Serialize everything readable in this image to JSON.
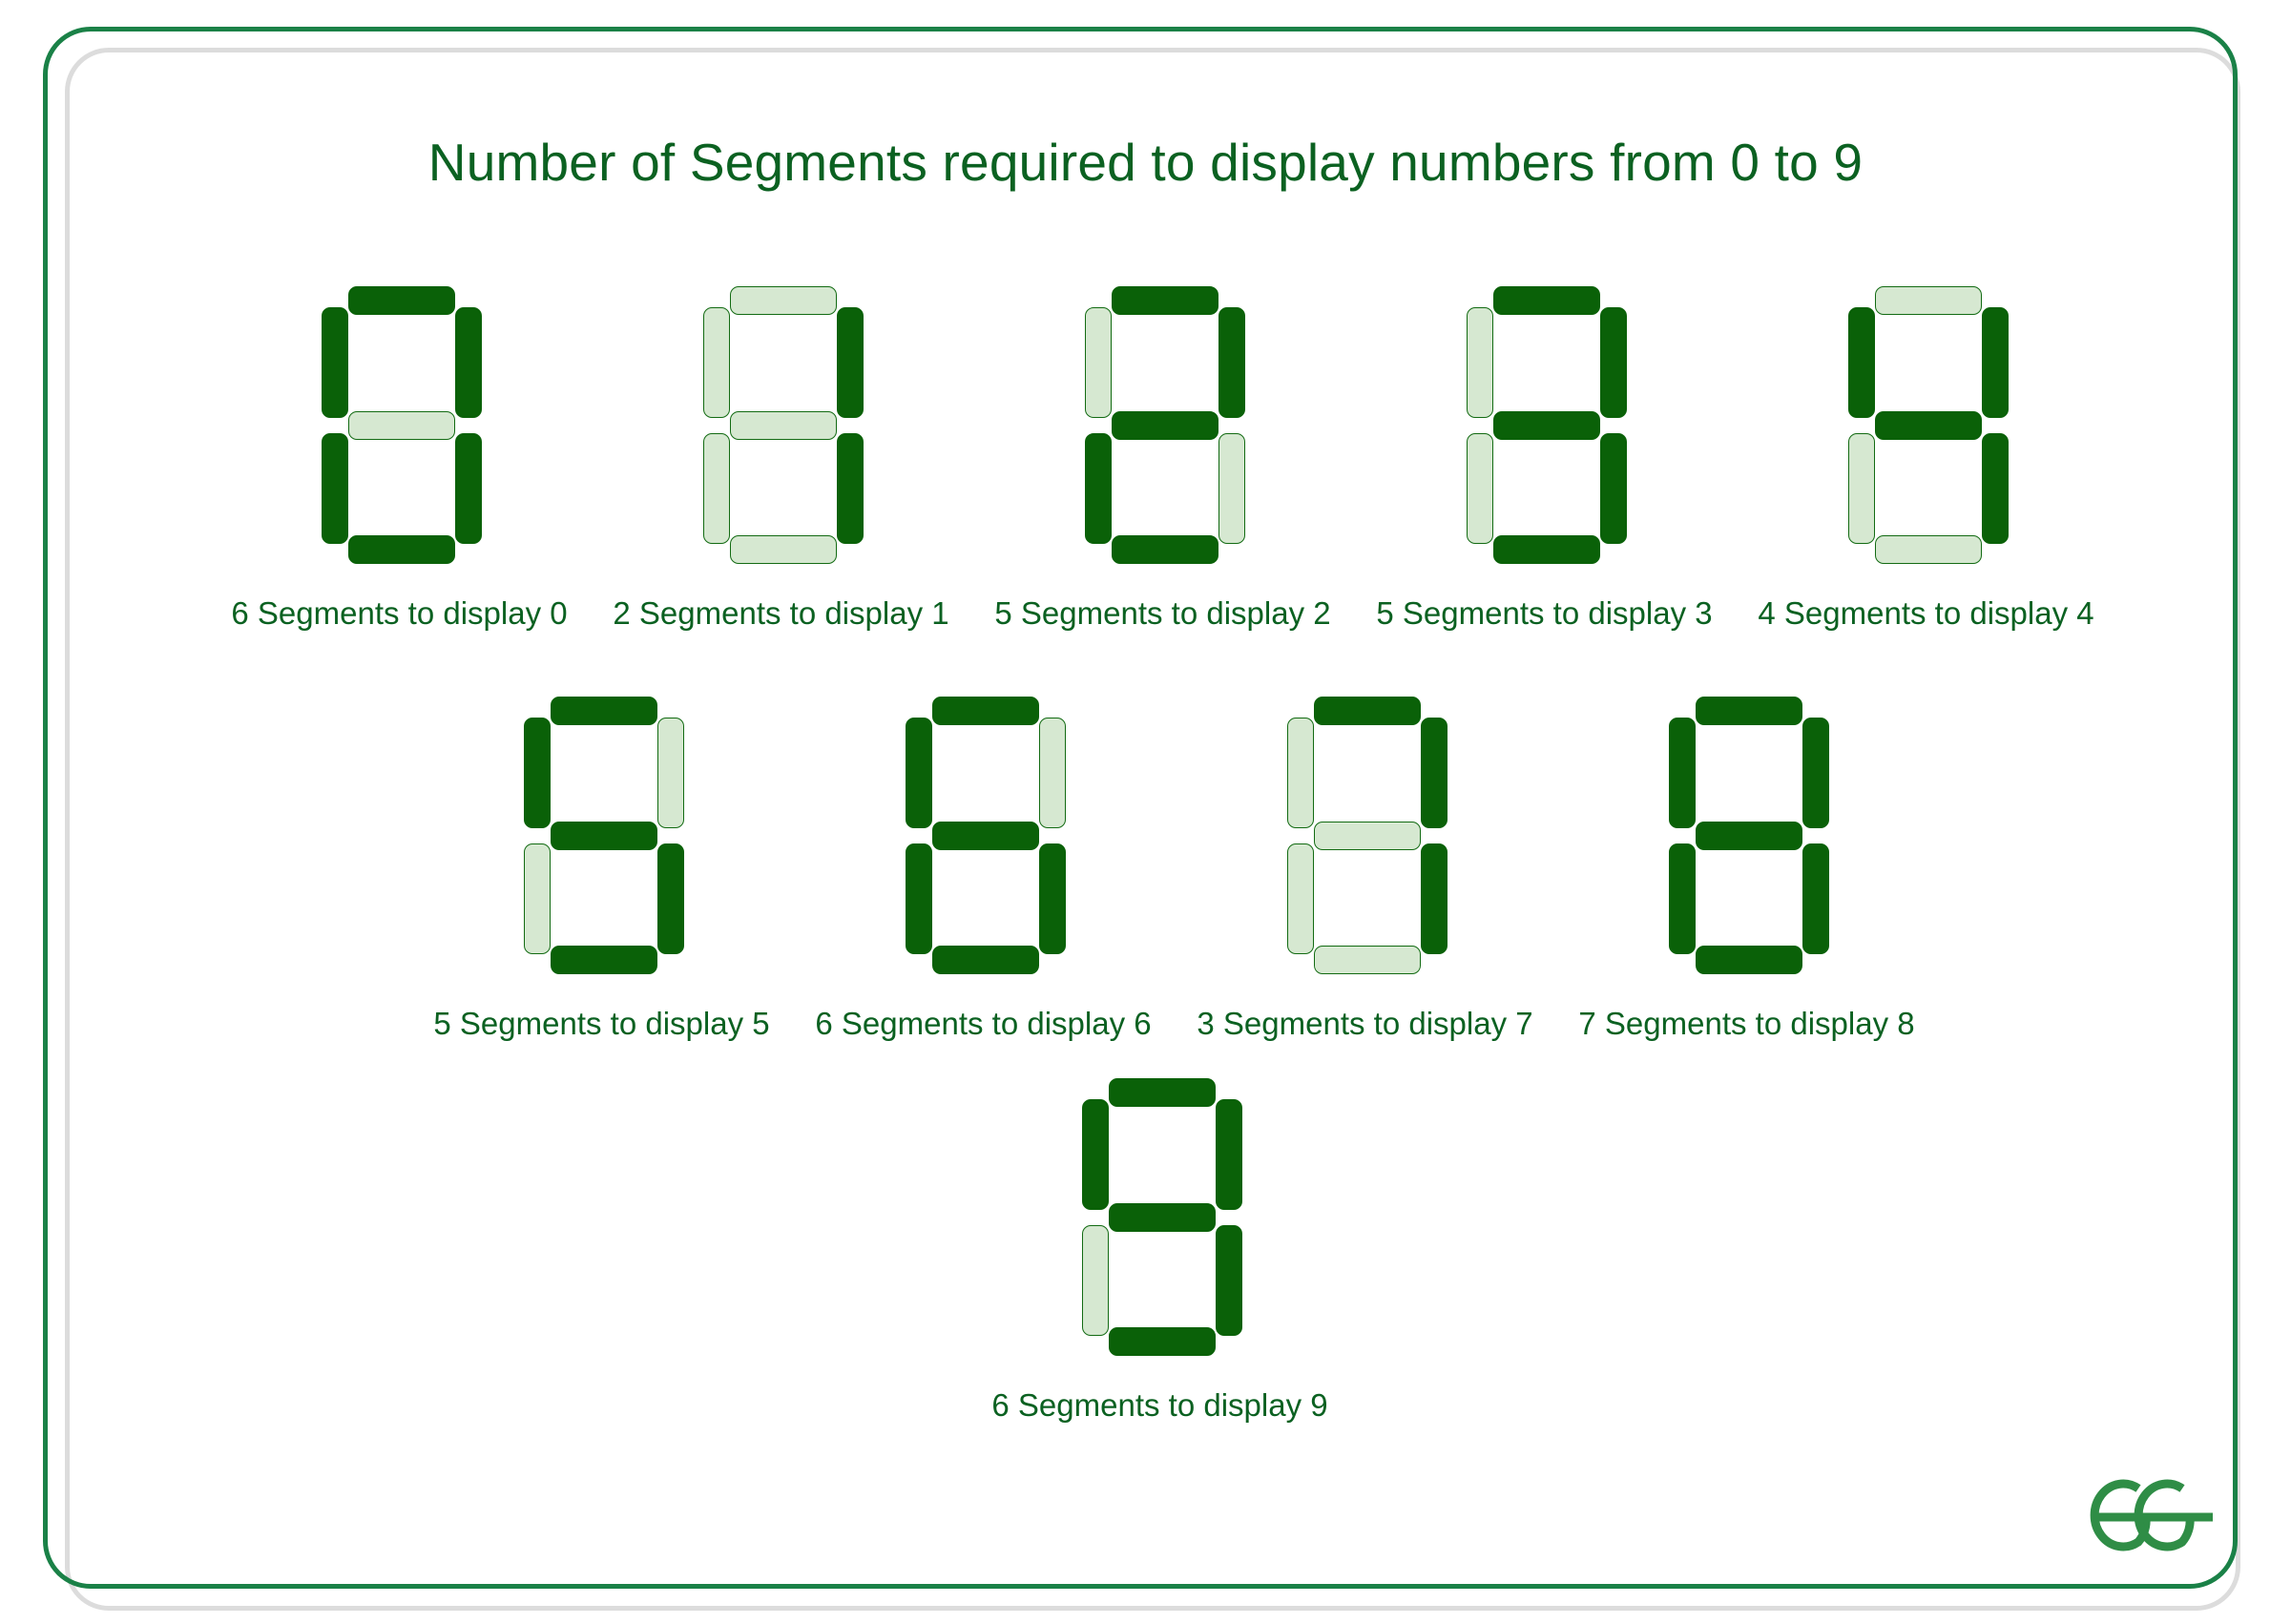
{
  "title": "Number of Segments required to display numbers from 0 to 9",
  "colors": {
    "segment_on": "#0a6108",
    "segment_off": "#d6e8d1",
    "segment_off_border": "#136b13",
    "text": "#0b6121",
    "frame_outer": "#1a8147",
    "frame_inner": "#dcdcdc",
    "logo": "#2f8d46",
    "background": "#ffffff"
  },
  "logo": {
    "name": "geeksforgeeks-logo",
    "text": "GG"
  },
  "segment_order": [
    "a",
    "b",
    "c",
    "d",
    "e",
    "f",
    "g"
  ],
  "rows": [
    {
      "digits": [
        {
          "value": "0",
          "count": 6,
          "caption": "6 Segments to display 0",
          "segments": {
            "a": true,
            "b": true,
            "c": true,
            "d": true,
            "e": true,
            "f": true,
            "g": false
          }
        },
        {
          "value": "1",
          "count": 2,
          "caption": "2 Segments to display 1",
          "segments": {
            "a": false,
            "b": true,
            "c": true,
            "d": false,
            "e": false,
            "f": false,
            "g": false
          }
        },
        {
          "value": "2",
          "count": 5,
          "caption": "5 Segments to display 2",
          "segments": {
            "a": true,
            "b": true,
            "c": false,
            "d": true,
            "e": true,
            "f": false,
            "g": true
          }
        },
        {
          "value": "3",
          "count": 5,
          "caption": "5 Segments to display 3",
          "segments": {
            "a": true,
            "b": true,
            "c": true,
            "d": true,
            "e": false,
            "f": false,
            "g": true
          }
        },
        {
          "value": "4",
          "count": 4,
          "caption": "4 Segments to display 4",
          "segments": {
            "a": false,
            "b": true,
            "c": true,
            "d": false,
            "e": false,
            "f": true,
            "g": true
          }
        }
      ]
    },
    {
      "digits": [
        {
          "value": "5",
          "count": 5,
          "caption": "5 Segments to display 5",
          "segments": {
            "a": true,
            "b": false,
            "c": true,
            "d": true,
            "e": false,
            "f": true,
            "g": true
          }
        },
        {
          "value": "6",
          "count": 6,
          "caption": "6 Segments to display 6",
          "segments": {
            "a": true,
            "b": false,
            "c": true,
            "d": true,
            "e": true,
            "f": true,
            "g": true
          }
        },
        {
          "value": "7",
          "count": 3,
          "caption": "3 Segments to display 7",
          "segments": {
            "a": true,
            "b": true,
            "c": true,
            "d": false,
            "e": false,
            "f": false,
            "g": false
          }
        },
        {
          "value": "8",
          "count": 7,
          "caption": "7 Segments to display 8",
          "segments": {
            "a": true,
            "b": true,
            "c": true,
            "d": true,
            "e": true,
            "f": true,
            "g": true
          }
        }
      ]
    },
    {
      "digits": [
        {
          "value": "9",
          "count": 6,
          "caption": "6 Segments to display 9",
          "segments": {
            "a": true,
            "b": true,
            "c": true,
            "d": true,
            "e": false,
            "f": true,
            "g": true
          }
        }
      ]
    }
  ]
}
